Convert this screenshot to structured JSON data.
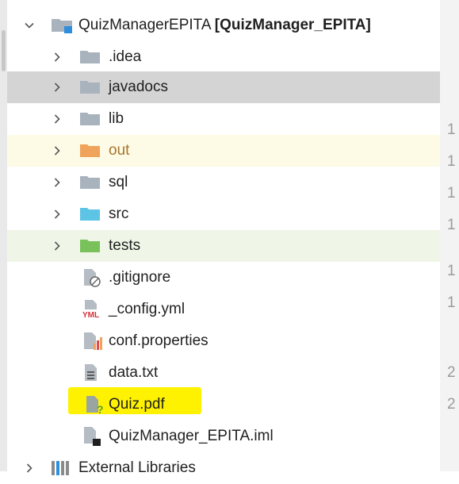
{
  "project": {
    "name": "QuizManagerEPITA",
    "module": "[QuizManager_EPITA]"
  },
  "tree": {
    "folders": [
      {
        "label": ".idea",
        "color": "#a9b3bd"
      },
      {
        "label": "javadocs",
        "color": "#a9b3bd"
      },
      {
        "label": "lib",
        "color": "#a9b3bd"
      },
      {
        "label": "out",
        "color": "#f0a35a"
      },
      {
        "label": "sql",
        "color": "#a9b3bd"
      },
      {
        "label": "src",
        "color": "#5ec4e6"
      },
      {
        "label": "tests",
        "color": "#79c15a"
      }
    ],
    "files": [
      {
        "label": ".gitignore",
        "icon": "gitignore-file-icon"
      },
      {
        "label": "_config.yml",
        "icon": "yml-file-icon",
        "badge": "YML"
      },
      {
        "label": "conf.properties",
        "icon": "properties-file-icon"
      },
      {
        "label": "data.txt",
        "icon": "text-file-icon"
      },
      {
        "label": "Quiz.pdf",
        "icon": "unknown-file-icon"
      },
      {
        "label": "QuizManager_EPITA.iml",
        "icon": "iml-file-icon"
      }
    ],
    "external": {
      "label": "External Libraries"
    }
  },
  "gutter_numbers": [
    "1",
    "1",
    "1",
    "1",
    "1",
    "1",
    "2",
    "2"
  ]
}
